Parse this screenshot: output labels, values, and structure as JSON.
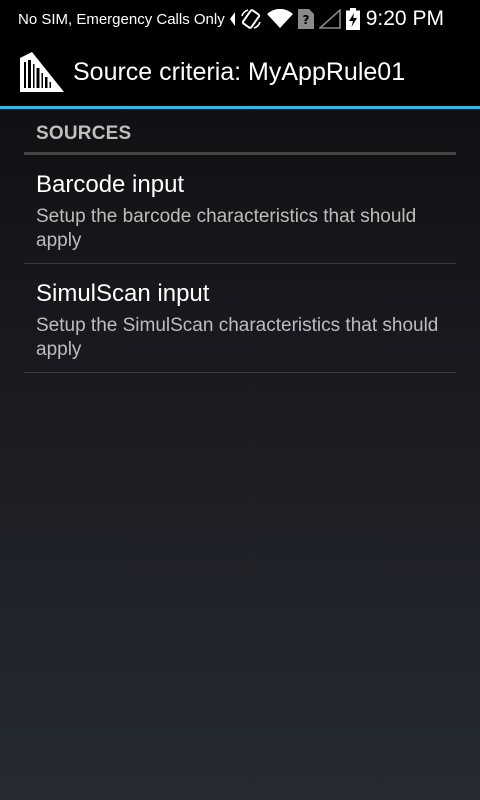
{
  "status_bar": {
    "carrier_text": "No SIM, Emergency Calls Only",
    "time": "9:20 PM",
    "icons": [
      "data-arrow-icon",
      "rotate-icon",
      "wifi-icon",
      "sim-unknown-icon",
      "signal-empty-icon",
      "battery-charging-icon"
    ]
  },
  "action_bar": {
    "title": "Source criteria: MyAppRule01",
    "icon": "barcode-scanner-icon",
    "accent_color": "#33b5e5"
  },
  "sources": {
    "header": "SOURCES",
    "items": [
      {
        "title": "Barcode input",
        "summary": "Setup the barcode characteristics that should apply"
      },
      {
        "title": "SimulScan input",
        "summary": "Setup the SimulScan characteristics that should apply"
      }
    ]
  }
}
